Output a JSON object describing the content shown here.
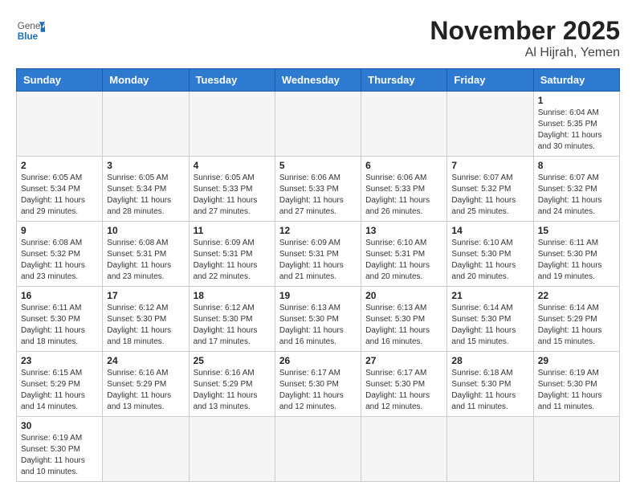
{
  "logo": {
    "general": "General",
    "blue": "Blue"
  },
  "header": {
    "month": "November 2025",
    "location": "Al Hijrah, Yemen"
  },
  "weekdays": [
    "Sunday",
    "Monday",
    "Tuesday",
    "Wednesday",
    "Thursday",
    "Friday",
    "Saturday"
  ],
  "weeks": [
    [
      {
        "day": "",
        "info": ""
      },
      {
        "day": "",
        "info": ""
      },
      {
        "day": "",
        "info": ""
      },
      {
        "day": "",
        "info": ""
      },
      {
        "day": "",
        "info": ""
      },
      {
        "day": "",
        "info": ""
      },
      {
        "day": "1",
        "info": "Sunrise: 6:04 AM\nSunset: 5:35 PM\nDaylight: 11 hours\nand 30 minutes."
      }
    ],
    [
      {
        "day": "2",
        "info": "Sunrise: 6:05 AM\nSunset: 5:34 PM\nDaylight: 11 hours\nand 29 minutes."
      },
      {
        "day": "3",
        "info": "Sunrise: 6:05 AM\nSunset: 5:34 PM\nDaylight: 11 hours\nand 28 minutes."
      },
      {
        "day": "4",
        "info": "Sunrise: 6:05 AM\nSunset: 5:33 PM\nDaylight: 11 hours\nand 27 minutes."
      },
      {
        "day": "5",
        "info": "Sunrise: 6:06 AM\nSunset: 5:33 PM\nDaylight: 11 hours\nand 27 minutes."
      },
      {
        "day": "6",
        "info": "Sunrise: 6:06 AM\nSunset: 5:33 PM\nDaylight: 11 hours\nand 26 minutes."
      },
      {
        "day": "7",
        "info": "Sunrise: 6:07 AM\nSunset: 5:32 PM\nDaylight: 11 hours\nand 25 minutes."
      },
      {
        "day": "8",
        "info": "Sunrise: 6:07 AM\nSunset: 5:32 PM\nDaylight: 11 hours\nand 24 minutes."
      }
    ],
    [
      {
        "day": "9",
        "info": "Sunrise: 6:08 AM\nSunset: 5:32 PM\nDaylight: 11 hours\nand 23 minutes."
      },
      {
        "day": "10",
        "info": "Sunrise: 6:08 AM\nSunset: 5:31 PM\nDaylight: 11 hours\nand 23 minutes."
      },
      {
        "day": "11",
        "info": "Sunrise: 6:09 AM\nSunset: 5:31 PM\nDaylight: 11 hours\nand 22 minutes."
      },
      {
        "day": "12",
        "info": "Sunrise: 6:09 AM\nSunset: 5:31 PM\nDaylight: 11 hours\nand 21 minutes."
      },
      {
        "day": "13",
        "info": "Sunrise: 6:10 AM\nSunset: 5:31 PM\nDaylight: 11 hours\nand 20 minutes."
      },
      {
        "day": "14",
        "info": "Sunrise: 6:10 AM\nSunset: 5:30 PM\nDaylight: 11 hours\nand 20 minutes."
      },
      {
        "day": "15",
        "info": "Sunrise: 6:11 AM\nSunset: 5:30 PM\nDaylight: 11 hours\nand 19 minutes."
      }
    ],
    [
      {
        "day": "16",
        "info": "Sunrise: 6:11 AM\nSunset: 5:30 PM\nDaylight: 11 hours\nand 18 minutes."
      },
      {
        "day": "17",
        "info": "Sunrise: 6:12 AM\nSunset: 5:30 PM\nDaylight: 11 hours\nand 18 minutes."
      },
      {
        "day": "18",
        "info": "Sunrise: 6:12 AM\nSunset: 5:30 PM\nDaylight: 11 hours\nand 17 minutes."
      },
      {
        "day": "19",
        "info": "Sunrise: 6:13 AM\nSunset: 5:30 PM\nDaylight: 11 hours\nand 16 minutes."
      },
      {
        "day": "20",
        "info": "Sunrise: 6:13 AM\nSunset: 5:30 PM\nDaylight: 11 hours\nand 16 minutes."
      },
      {
        "day": "21",
        "info": "Sunrise: 6:14 AM\nSunset: 5:30 PM\nDaylight: 11 hours\nand 15 minutes."
      },
      {
        "day": "22",
        "info": "Sunrise: 6:14 AM\nSunset: 5:29 PM\nDaylight: 11 hours\nand 15 minutes."
      }
    ],
    [
      {
        "day": "23",
        "info": "Sunrise: 6:15 AM\nSunset: 5:29 PM\nDaylight: 11 hours\nand 14 minutes."
      },
      {
        "day": "24",
        "info": "Sunrise: 6:16 AM\nSunset: 5:29 PM\nDaylight: 11 hours\nand 13 minutes."
      },
      {
        "day": "25",
        "info": "Sunrise: 6:16 AM\nSunset: 5:29 PM\nDaylight: 11 hours\nand 13 minutes."
      },
      {
        "day": "26",
        "info": "Sunrise: 6:17 AM\nSunset: 5:30 PM\nDaylight: 11 hours\nand 12 minutes."
      },
      {
        "day": "27",
        "info": "Sunrise: 6:17 AM\nSunset: 5:30 PM\nDaylight: 11 hours\nand 12 minutes."
      },
      {
        "day": "28",
        "info": "Sunrise: 6:18 AM\nSunset: 5:30 PM\nDaylight: 11 hours\nand 11 minutes."
      },
      {
        "day": "29",
        "info": "Sunrise: 6:19 AM\nSunset: 5:30 PM\nDaylight: 11 hours\nand 11 minutes."
      }
    ],
    [
      {
        "day": "30",
        "info": "Sunrise: 6:19 AM\nSunset: 5:30 PM\nDaylight: 11 hours\nand 10 minutes."
      },
      {
        "day": "",
        "info": ""
      },
      {
        "day": "",
        "info": ""
      },
      {
        "day": "",
        "info": ""
      },
      {
        "day": "",
        "info": ""
      },
      {
        "day": "",
        "info": ""
      },
      {
        "day": "",
        "info": ""
      }
    ]
  ]
}
